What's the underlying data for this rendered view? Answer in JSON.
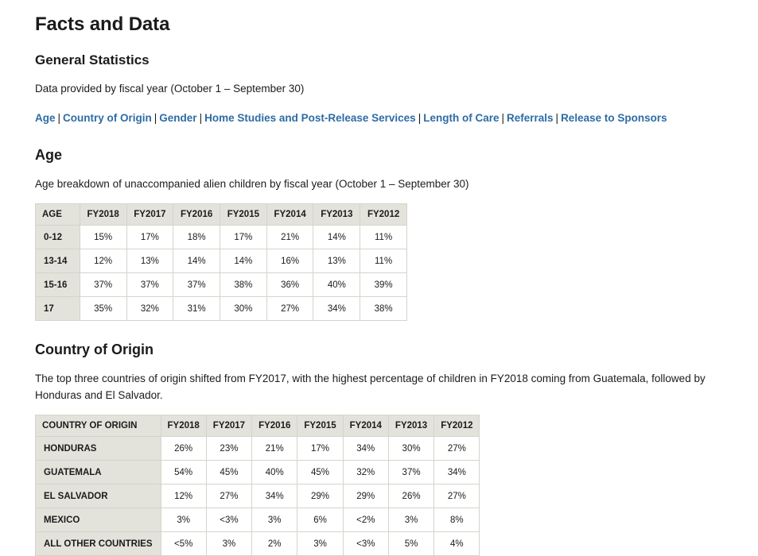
{
  "page": {
    "title": "Facts and Data"
  },
  "general_statistics": {
    "heading": "General Statistics",
    "intro": "Data provided by fiscal year (October 1 – September 30)",
    "nav_links": [
      "Age",
      "Country of Origin",
      "Gender",
      "Home Studies and Post-Release Services",
      "Length of Care",
      "Referrals",
      "Release to Sponsors"
    ],
    "nav_separator": "|"
  },
  "age_section": {
    "heading": "Age",
    "description": "Age breakdown of unaccompanied alien children by fiscal year (October 1 – September 30)",
    "table": {
      "columns": [
        "AGE",
        "FY2018",
        "FY2017",
        "FY2016",
        "FY2015",
        "FY2014",
        "FY2013",
        "FY2012"
      ],
      "rows": [
        {
          "label": "0-12",
          "values": [
            "15%",
            "17%",
            "18%",
            "17%",
            "21%",
            "14%",
            "11%"
          ]
        },
        {
          "label": "13-14",
          "values": [
            "12%",
            "13%",
            "14%",
            "14%",
            "16%",
            "13%",
            "11%"
          ]
        },
        {
          "label": "15-16",
          "values": [
            "37%",
            "37%",
            "37%",
            "38%",
            "36%",
            "40%",
            "39%"
          ]
        },
        {
          "label": "17",
          "values": [
            "35%",
            "32%",
            "31%",
            "30%",
            "27%",
            "34%",
            "38%"
          ]
        }
      ]
    }
  },
  "country_section": {
    "heading": "Country of Origin",
    "description": "The top three countries of origin shifted from FY2017, with the highest percentage of children in FY2018 coming from Guatemala, followed by Honduras and El Salvador.",
    "table": {
      "columns": [
        "COUNTRY OF ORIGIN",
        "FY2018",
        "FY2017",
        "FY2016",
        "FY2015",
        "FY2014",
        "FY2013",
        "FY2012"
      ],
      "rows": [
        {
          "label": "HONDURAS",
          "values": [
            "26%",
            "23%",
            "21%",
            "17%",
            "34%",
            "30%",
            "27%"
          ]
        },
        {
          "label": "GUATEMALA",
          "values": [
            "54%",
            "45%",
            "40%",
            "45%",
            "32%",
            "37%",
            "34%"
          ]
        },
        {
          "label": "EL SALVADOR",
          "values": [
            "12%",
            "27%",
            "34%",
            "29%",
            "29%",
            "26%",
            "27%"
          ]
        },
        {
          "label": "MEXICO",
          "values": [
            "3%",
            "<3%",
            "3%",
            "6%",
            "<2%",
            "3%",
            "8%"
          ]
        },
        {
          "label": "ALL OTHER COUNTRIES",
          "values": [
            "<5%",
            "3%",
            "2%",
            "3%",
            "<3%",
            "5%",
            "4%"
          ]
        }
      ]
    }
  },
  "colors": {
    "link": "#2e6ca4",
    "table_header_bg": "#e4e3db",
    "table_border": "#d5d4cc",
    "text": "#1b1b1b",
    "page_bg": "#ffffff"
  }
}
